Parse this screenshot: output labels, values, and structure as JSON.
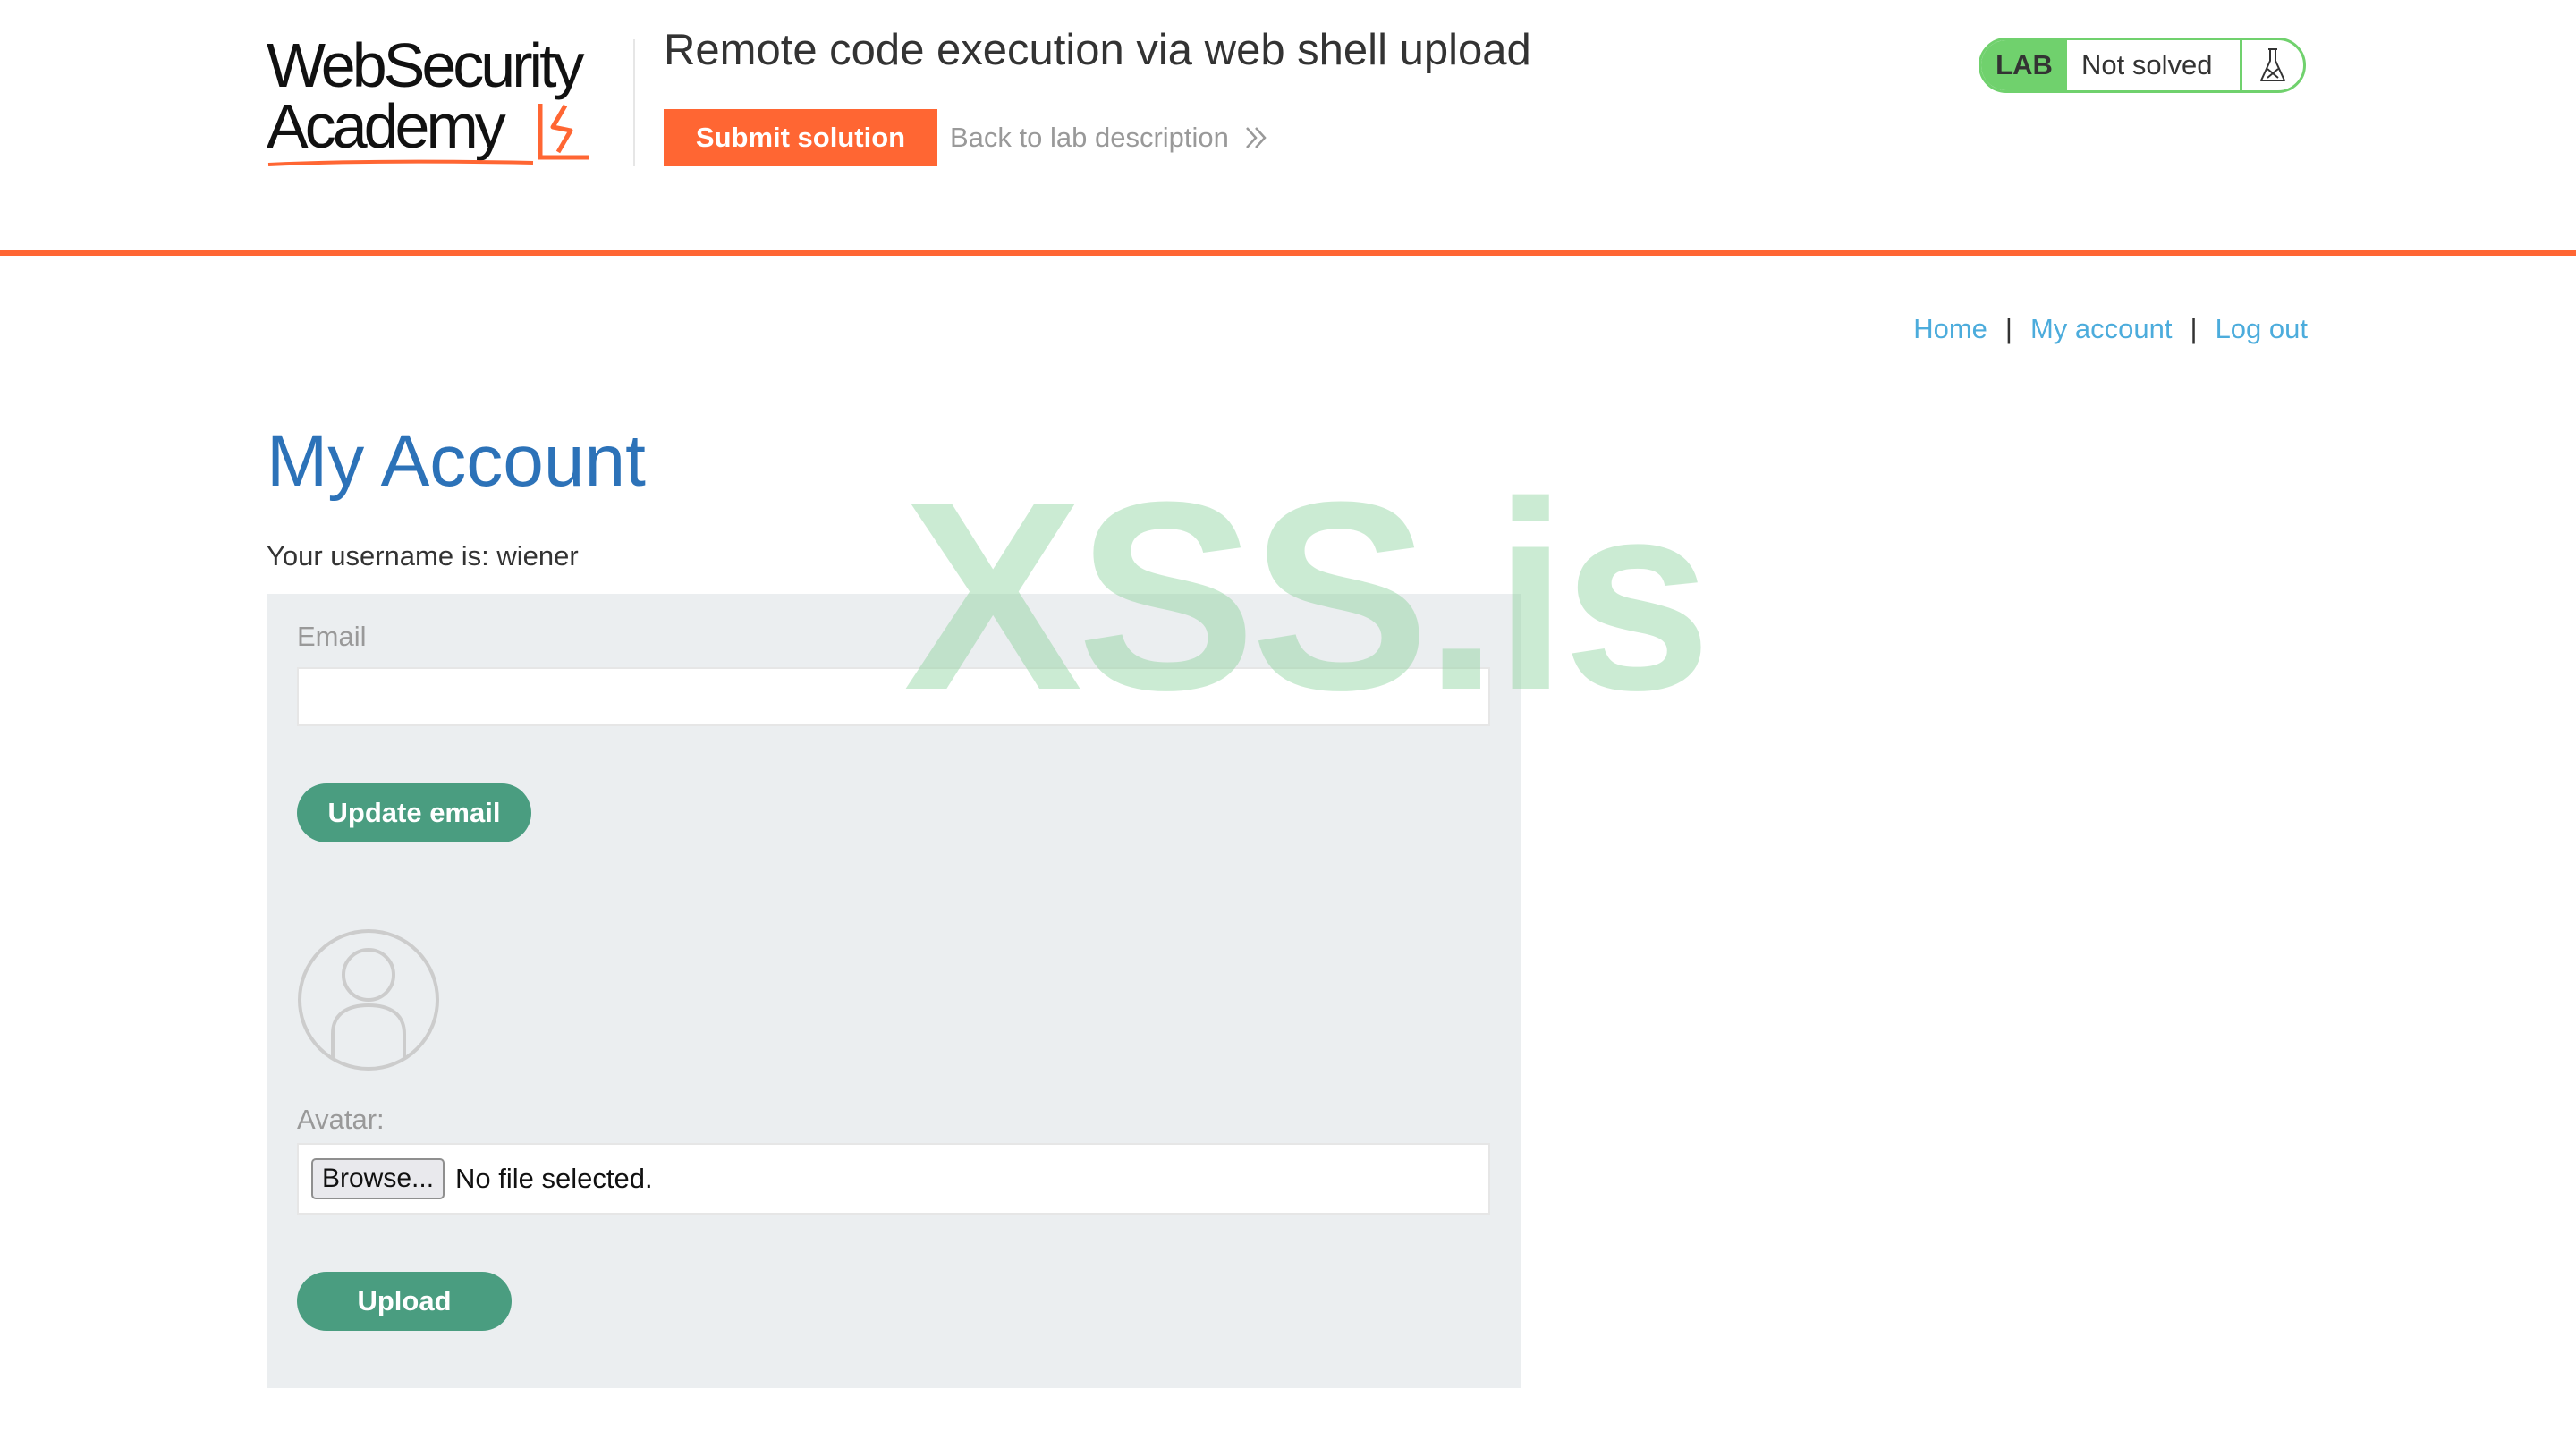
{
  "logo": {
    "line1": "WebSecurity",
    "line2": "Academy",
    "brand_color": "#ff6633"
  },
  "header": {
    "lab_title": "Remote code execution via web shell upload",
    "submit_label": "Submit solution",
    "back_label": "Back to lab description",
    "back_icon": "double-chevron-right-icon",
    "accent_color": "#ff6633"
  },
  "lab_status": {
    "badge": "LAB",
    "state": "Not solved",
    "icon": "flask-icon",
    "status_color": "#70d16d"
  },
  "nav": {
    "home": "Home",
    "separator": "|",
    "my_account": "My account",
    "log_out": "Log out",
    "link_color": "#4cacdc"
  },
  "page": {
    "title": "My Account",
    "username_line": "Your username is: wiener",
    "title_color": "#2c72b8"
  },
  "email_form": {
    "label": "Email",
    "value": "",
    "button_label": "Update email",
    "button_color": "#4a9d80"
  },
  "avatar_form": {
    "avatar_icon": "user-avatar-placeholder-icon",
    "label": "Avatar:",
    "browse_label": "Browse...",
    "file_status": "No file selected.",
    "upload_label": "Upload"
  },
  "watermark": {
    "text": "XSS.is"
  }
}
